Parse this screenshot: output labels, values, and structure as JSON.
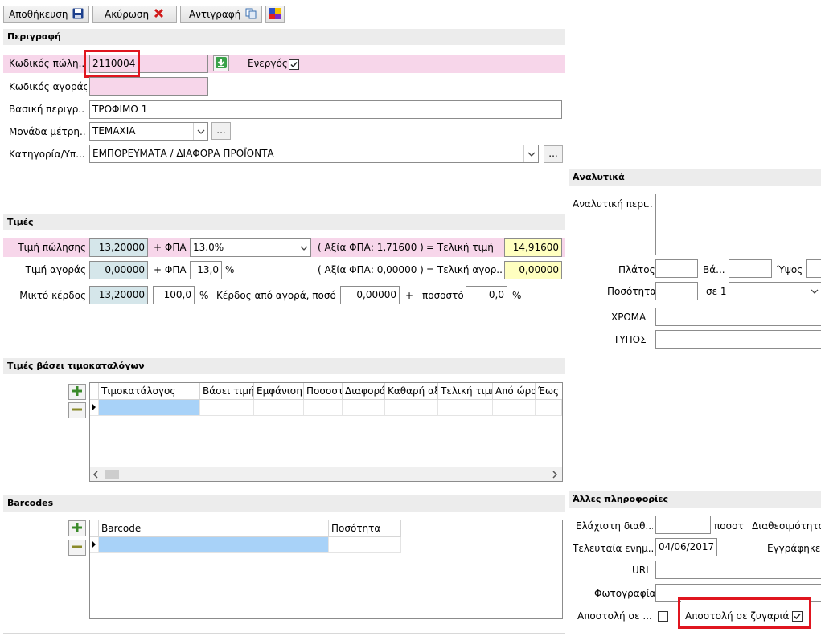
{
  "toolbar": {
    "save_label": "Αποθήκευση",
    "cancel_label": "Ακύρωση",
    "copy_label": "Αντιγραφή"
  },
  "description": {
    "header": "Περιγραφή",
    "sale_code_label": "Κωδικός πώλη...",
    "sale_code_value": "2110004",
    "active_label": "Ενεργός",
    "purchase_code_label": "Κωδικός αγοράς",
    "purchase_code_value": "",
    "basic_desc_label": "Βασική περιγρ...",
    "basic_desc_value": "ΤΡΟΦΙΜΟ 1",
    "unit_label": "Μονάδα μέτρη...",
    "unit_value": "ΤΕΜΑΧΙΑ",
    "category_label": "Κατηγορία/Υπ...",
    "category_value": "ΕΜΠΟΡΕΥΜΑΤΑ / ΔΙΑΦΟΡΑ ΠΡΟΪΟΝΤΑ",
    "dots": "..."
  },
  "prices": {
    "header": "Τιμές",
    "sale_price_label": "Τιμή πώλησης",
    "sale_price_value": "13,20000",
    "vat_label": "+ ΦΠΑ",
    "sale_vat_value": "13.0%",
    "sale_vat_amount_text": "( Αξία ΦΠΑ: 1,71600 )",
    "final_price_label": "= Τελική τιμή",
    "final_price_value": "14,91600",
    "purchase_price_label": "Τιμή αγοράς",
    "purchase_price_value": "0,00000",
    "purchase_vat_value": "13,0",
    "percent": "%",
    "purchase_vat_amount_text": "( Αξία ΦΠΑ: 0,00000 )",
    "final_purchase_label": "= Τελική αγορ...",
    "final_purchase_value": "0,00000",
    "gross_profit_label": "Μικτό κέρδος",
    "gross_profit_value": "13,20000",
    "gross_profit_pct": "100,0",
    "profit_from_purchase_label": "Κέρδος από αγορά, ποσό",
    "profit_amount": "0,00000",
    "plus": "+",
    "pct_label": "ποσοστό",
    "profit_pct": "0,0"
  },
  "pricelists": {
    "header": "Τιμές βάσει τιμοκαταλόγων",
    "columns": [
      "Τιμοκατάλογος",
      "Βάσει τιμή",
      "Εμφάνιση",
      "Ποσοστ",
      "Διαφορά",
      "Καθαρή αξ",
      "Τελική τιμή",
      "Από ώρα",
      "Έως"
    ]
  },
  "barcodes": {
    "header": "Barcodes",
    "columns": [
      "Barcode",
      "Ποσότητα"
    ]
  },
  "analytics": {
    "header": "Αναλυτικά",
    "detailed_desc_label": "Αναλυτική περι...",
    "width_label": "Πλάτος",
    "weight_label": "Βά...",
    "height_label": "Ύψος",
    "quantity_label": "Ποσότητα",
    "in_one_label": "σε 1",
    "color_label": "ΧΡΩΜΑ",
    "type_label": "ΤΥΠΟΣ"
  },
  "other": {
    "header": "Άλλες πληροφορίες",
    "min_avail_label": "Ελάχιστη διαθ...",
    "qty_short_label": "ποσοτ",
    "availability_label": "Διαθεσιμότητα",
    "last_update_label": "Τελευταία ενημ...",
    "last_update_value": "04/06/2017",
    "registered_label": "Εγγράφηκε",
    "url_label": "URL",
    "photo_label": "Φωτογραφία",
    "send_to_label": "Αποστολή σε ...",
    "send_to_scale_label": "Αποστολή σε ζυγαριά"
  },
  "colors": {
    "pink": "#f7d6ea",
    "blue": "#d5e6ea",
    "yellow": "#ffffc0",
    "highlight": "#e0151f",
    "selected_cell": "#a8d2f8"
  }
}
